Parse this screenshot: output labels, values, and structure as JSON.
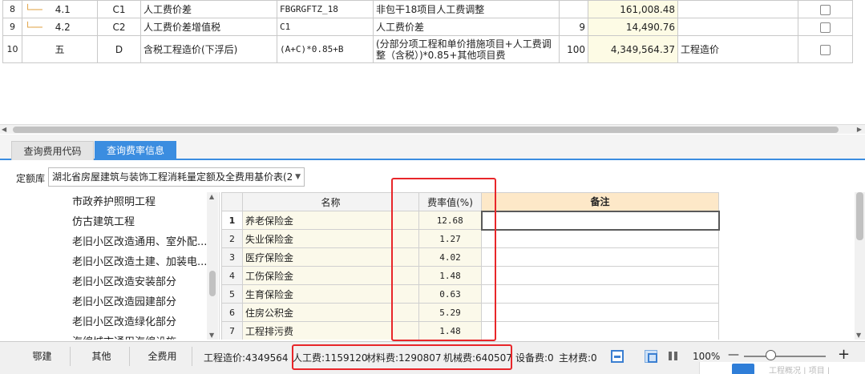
{
  "top_rows": [
    {
      "no": "8",
      "seq": "4.1",
      "code": "C1",
      "name": "人工费价差",
      "base": "FBGRGFTZ_18",
      "base_desc": "非包干18项目人工费调整",
      "qty": "",
      "amount": "161,008.48",
      "cat": ""
    },
    {
      "no": "9",
      "seq": "4.2",
      "code": "C2",
      "name": "人工费价差增值税",
      "base": "C1",
      "base_desc": "人工费价差",
      "qty": "9",
      "amount": "14,490.76",
      "cat": ""
    },
    {
      "no": "10",
      "seq": "五",
      "code": "D",
      "name": "含税工程造价(下浮后)",
      "base": "(A+C)*0.85+B",
      "base_desc": "(分部分项工程和单价措施项目+人工费调整（含税）)*0.85+其他项目费",
      "qty": "100",
      "amount": "4,349,564.37",
      "cat": "工程造价"
    }
  ],
  "tabs": {
    "tab1": "查询费用代码",
    "tab2": "查询费率信息"
  },
  "filter": {
    "label": "定额库",
    "value": "湖北省房屋建筑与装饰工程消耗量定额及全费用基价表(2"
  },
  "tree_items": [
    "市政养护照明工程",
    "仿古建筑工程",
    "老旧小区改造通用、室外配...",
    "老旧小区改造土建、加装电...",
    "老旧小区改造安装部分",
    "老旧小区改造园建部分",
    "老旧小区改造绿化部分",
    "海绵城市通用海绵设施..."
  ],
  "rate_table": {
    "headers": {
      "name": "名称",
      "rate": "费率值(%)",
      "remark": "备注"
    },
    "rows": [
      {
        "idx": "1",
        "name": "养老保险金",
        "rate": "12.68"
      },
      {
        "idx": "2",
        "name": "失业保险金",
        "rate": "1.27"
      },
      {
        "idx": "3",
        "name": "医疗保险金",
        "rate": "4.02"
      },
      {
        "idx": "4",
        "name": "工伤保险金",
        "rate": "1.48"
      },
      {
        "idx": "5",
        "name": "生育保险金",
        "rate": "0.63"
      },
      {
        "idx": "6",
        "name": "住房公积金",
        "rate": "5.29"
      },
      {
        "idx": "7",
        "name": "工程排污费",
        "rate": "1.48"
      }
    ]
  },
  "status": {
    "btn1": "鄂建",
    "btn2": "其他",
    "btn3": "全费用",
    "project_cost": "工程造价:4349564",
    "labor": "人工费:1159120",
    "material": "材料费:1290807",
    "machine": "机械费:640507",
    "equipment": "设备费:0",
    "main_material": "主材费:0",
    "zoom": "100%",
    "zoom_level": 0.33,
    "minus": "—",
    "plus": "+"
  },
  "peek_text": "工程概况 | 项目 |",
  "colors": {
    "accent": "#3b8de0",
    "highlight": "#e8262a",
    "remark_header": "#fde8c8"
  }
}
